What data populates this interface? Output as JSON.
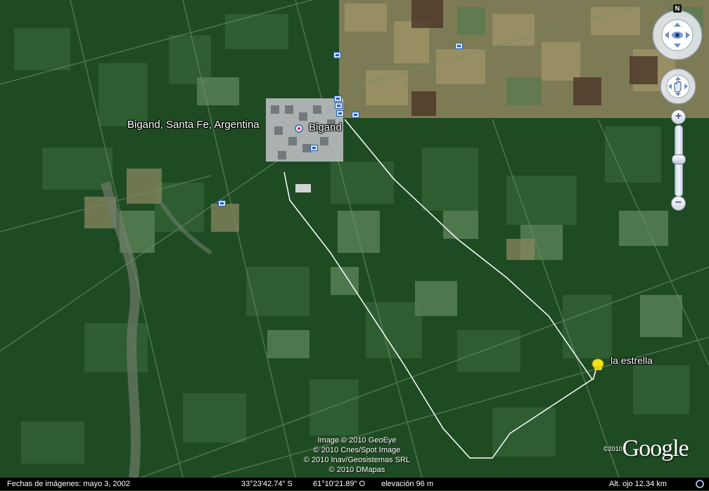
{
  "map": {
    "labels": {
      "place_full": "Bigand, Santa Fe, Argentina",
      "town": "Bigand",
      "placemark": "la estrella"
    },
    "copyright_lines": [
      "Image © 2010 GeoEye",
      "© 2010 Cnes/Spot Image",
      "© 2010 Inav/Geosistemas SRL",
      "© 2010 DMapas"
    ],
    "logo": {
      "year": "©2010",
      "text": "Google"
    }
  },
  "navigation": {
    "compass_north": "N",
    "zoom_in": "+",
    "zoom_out": "−",
    "icons": [
      "look-joystick-icon",
      "move-hand-icon",
      "zoom-slider-icon"
    ]
  },
  "status_bar": {
    "imagery_date": "Fechas de imágenes: mayo  3, 2002",
    "latitude": "33°23'42.74\" S",
    "longitude": "61°10'21.89\" O",
    "elevation": "elevación   96 m",
    "eye_altitude": "Alt. ojo   12.34 km"
  },
  "colors": {
    "fields_dark": "#1d4a21",
    "fields_mid": "#2f5e32",
    "fields_light": "#4e7a4e",
    "farmland_tan": "#8f8a5f",
    "route": "#ffffff",
    "pin": "#f2e21a"
  }
}
